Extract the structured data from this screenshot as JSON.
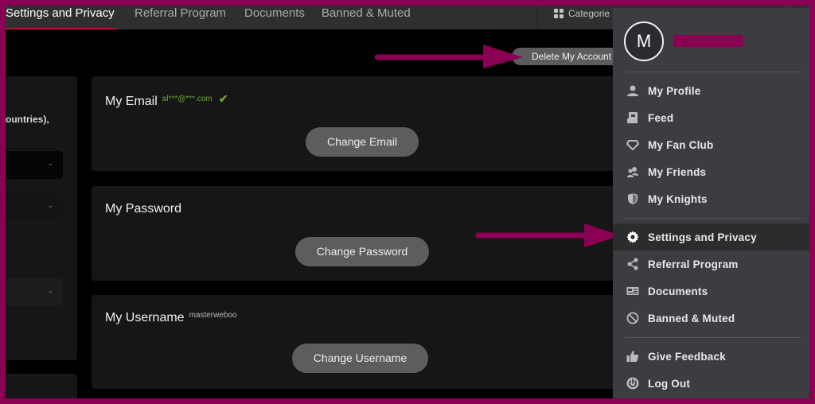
{
  "topnav": {
    "tabs": [
      {
        "label": "Settings and Privacy",
        "active": true
      },
      {
        "label": "Referral Program",
        "active": false
      },
      {
        "label": "Documents",
        "active": false
      },
      {
        "label": "Banned & Muted",
        "active": false
      }
    ],
    "categories_label": "Categorie"
  },
  "actions": {
    "delete_account_label": "Delete My Account"
  },
  "left_panel": {
    "partial_text": "ountries),"
  },
  "cards": {
    "email": {
      "title": "My Email",
      "value": "al***@***.com",
      "verified_icon": "check-icon",
      "button_label": "Change Email"
    },
    "password": {
      "title": "My Password",
      "button_label": "Change Password"
    },
    "username": {
      "title": "My Username",
      "value": "masterweboo",
      "button_label": "Change Username"
    }
  },
  "menu": {
    "avatar_initial": "M",
    "groups": [
      [
        {
          "label": "My Profile",
          "icon": "person-icon"
        },
        {
          "label": "Feed",
          "icon": "feed-icon"
        },
        {
          "label": "My Fan Club",
          "icon": "diamond-icon"
        },
        {
          "label": "My Friends",
          "icon": "friends-icon"
        },
        {
          "label": "My Knights",
          "icon": "shield-icon"
        }
      ],
      [
        {
          "label": "Settings and Privacy",
          "icon": "gear-icon",
          "active": true
        },
        {
          "label": "Referral Program",
          "icon": "share-icon"
        },
        {
          "label": "Documents",
          "icon": "id-card-icon"
        },
        {
          "label": "Banned & Muted",
          "icon": "ban-icon"
        }
      ],
      [
        {
          "label": "Give Feedback",
          "icon": "thumbs-up-icon"
        },
        {
          "label": "Log Out",
          "icon": "power-icon"
        }
      ]
    ]
  },
  "annotation": {
    "arrow_color": "#8a0052",
    "frame_color": "#8a0052"
  }
}
